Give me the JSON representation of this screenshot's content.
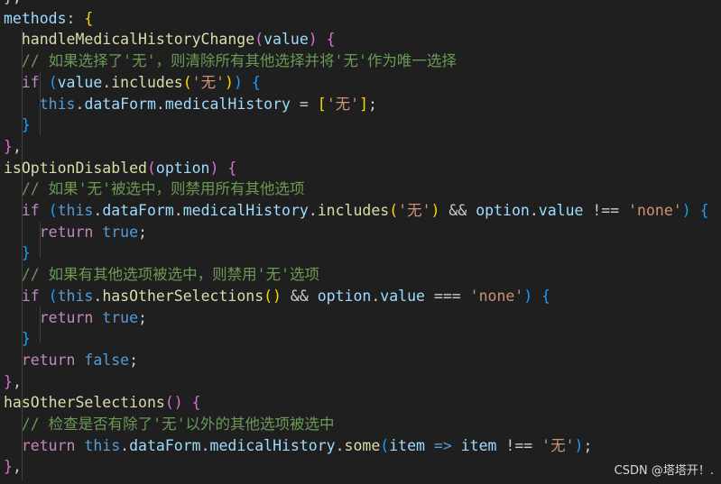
{
  "colors": {
    "background": "#1f1f1f",
    "plain": "#cccccc",
    "property": "#9cdcfe",
    "function": "#dcdcaa",
    "keyword": "#c586c0",
    "constant": "#569cd6",
    "string": "#ce9178",
    "comment": "#6a9955",
    "bracket_gold": "#ffd700",
    "bracket_pink": "#da70d6",
    "bracket_blue": "#179fff"
  },
  "code_lines": [
    [
      [
        "plain",
        "},"
      ]
    ],
    [
      [
        "prop",
        "methods"
      ],
      [
        "plain",
        ": "
      ],
      [
        "br-gold",
        "{"
      ]
    ],
    [
      [
        "plain",
        "  "
      ],
      [
        "func",
        "handleMedicalHistoryChange"
      ],
      [
        "br-pink",
        "("
      ],
      [
        "prop",
        "value"
      ],
      [
        "br-pink",
        ")"
      ],
      [
        "plain",
        " "
      ],
      [
        "br-pink",
        "{"
      ]
    ],
    [
      [
        "plain",
        "  "
      ],
      [
        "cmt",
        "// 如果选择了'无'，则清除所有其他选择并将'无'作为唯一选择"
      ]
    ],
    [
      [
        "plain",
        "  "
      ],
      [
        "kw",
        "if"
      ],
      [
        "plain",
        " "
      ],
      [
        "br-blue",
        "("
      ],
      [
        "prop",
        "value"
      ],
      [
        "plain",
        "."
      ],
      [
        "func",
        "includes"
      ],
      [
        "br-gold",
        "("
      ],
      [
        "str",
        "'无'"
      ],
      [
        "br-gold",
        ")"
      ],
      [
        "br-blue",
        ")"
      ],
      [
        "plain",
        " "
      ],
      [
        "br-blue",
        "{"
      ]
    ],
    [
      [
        "plain",
        "    "
      ],
      [
        "const",
        "this"
      ],
      [
        "plain",
        "."
      ],
      [
        "prop",
        "dataForm"
      ],
      [
        "plain",
        "."
      ],
      [
        "prop",
        "medicalHistory"
      ],
      [
        "plain",
        " = "
      ],
      [
        "br-gold",
        "["
      ],
      [
        "str",
        "'无'"
      ],
      [
        "br-gold",
        "]"
      ],
      [
        "plain",
        ";"
      ]
    ],
    [
      [
        "plain",
        "  "
      ],
      [
        "br-blue",
        "}"
      ]
    ],
    [
      [
        "br-pink",
        "}"
      ],
      [
        "plain",
        ","
      ]
    ],
    [
      [
        "func",
        "isOptionDisabled"
      ],
      [
        "br-pink",
        "("
      ],
      [
        "prop",
        "option"
      ],
      [
        "br-pink",
        ")"
      ],
      [
        "plain",
        " "
      ],
      [
        "br-pink",
        "{"
      ]
    ],
    [
      [
        "plain",
        "  "
      ],
      [
        "cmt",
        "// 如果'无'被选中，则禁用所有其他选项"
      ]
    ],
    [
      [
        "plain",
        "  "
      ],
      [
        "kw",
        "if"
      ],
      [
        "plain",
        " "
      ],
      [
        "br-blue",
        "("
      ],
      [
        "const",
        "this"
      ],
      [
        "plain",
        "."
      ],
      [
        "prop",
        "dataForm"
      ],
      [
        "plain",
        "."
      ],
      [
        "prop",
        "medicalHistory"
      ],
      [
        "plain",
        "."
      ],
      [
        "func",
        "includes"
      ],
      [
        "br-gold",
        "("
      ],
      [
        "str",
        "'无'"
      ],
      [
        "br-gold",
        ")"
      ],
      [
        "plain",
        " && "
      ],
      [
        "prop",
        "option"
      ],
      [
        "plain",
        "."
      ],
      [
        "prop",
        "value"
      ],
      [
        "plain",
        " !== "
      ],
      [
        "str",
        "'none'"
      ],
      [
        "br-blue",
        ")"
      ],
      [
        "plain",
        " "
      ],
      [
        "br-blue",
        "{"
      ]
    ],
    [
      [
        "plain",
        "    "
      ],
      [
        "kw",
        "return"
      ],
      [
        "plain",
        " "
      ],
      [
        "const",
        "true"
      ],
      [
        "plain",
        ";"
      ]
    ],
    [
      [
        "plain",
        "  "
      ],
      [
        "br-blue",
        "}"
      ]
    ],
    [
      [
        "plain",
        "  "
      ],
      [
        "cmt",
        "// 如果有其他选项被选中，则禁用'无'选项"
      ]
    ],
    [
      [
        "plain",
        "  "
      ],
      [
        "kw",
        "if"
      ],
      [
        "plain",
        " "
      ],
      [
        "br-blue",
        "("
      ],
      [
        "const",
        "this"
      ],
      [
        "plain",
        "."
      ],
      [
        "func",
        "hasOtherSelections"
      ],
      [
        "br-gold",
        "()"
      ],
      [
        "plain",
        " && "
      ],
      [
        "prop",
        "option"
      ],
      [
        "plain",
        "."
      ],
      [
        "prop",
        "value"
      ],
      [
        "plain",
        " === "
      ],
      [
        "str",
        "'none'"
      ],
      [
        "br-blue",
        ")"
      ],
      [
        "plain",
        " "
      ],
      [
        "br-blue",
        "{"
      ]
    ],
    [
      [
        "plain",
        "    "
      ],
      [
        "kw",
        "return"
      ],
      [
        "plain",
        " "
      ],
      [
        "const",
        "true"
      ],
      [
        "plain",
        ";"
      ]
    ],
    [
      [
        "plain",
        "  "
      ],
      [
        "br-blue",
        "}"
      ]
    ],
    [
      [
        "plain",
        "  "
      ],
      [
        "kw",
        "return"
      ],
      [
        "plain",
        " "
      ],
      [
        "const",
        "false"
      ],
      [
        "plain",
        ";"
      ]
    ],
    [
      [
        "br-pink",
        "}"
      ],
      [
        "plain",
        ","
      ]
    ],
    [
      [
        "func",
        "hasOtherSelections"
      ],
      [
        "br-pink",
        "()"
      ],
      [
        "plain",
        " "
      ],
      [
        "br-pink",
        "{"
      ]
    ],
    [
      [
        "plain",
        "  "
      ],
      [
        "cmt",
        "// 检查是否有除了'无'以外的其他选项被选中"
      ]
    ],
    [
      [
        "plain",
        "  "
      ],
      [
        "kw",
        "return"
      ],
      [
        "plain",
        " "
      ],
      [
        "const",
        "this"
      ],
      [
        "plain",
        "."
      ],
      [
        "prop",
        "dataForm"
      ],
      [
        "plain",
        "."
      ],
      [
        "prop",
        "medicalHistory"
      ],
      [
        "plain",
        "."
      ],
      [
        "func",
        "some"
      ],
      [
        "br-blue",
        "("
      ],
      [
        "prop",
        "item"
      ],
      [
        "plain",
        " "
      ],
      [
        "const",
        "=>"
      ],
      [
        "plain",
        " "
      ],
      [
        "prop",
        "item"
      ],
      [
        "plain",
        " !== "
      ],
      [
        "str",
        "'无'"
      ],
      [
        "br-blue",
        ")"
      ],
      [
        "plain",
        ";"
      ]
    ],
    [
      [
        "br-pink",
        "}"
      ],
      [
        "plain",
        ","
      ]
    ]
  ],
  "watermark": "CSDN @塔塔开！."
}
